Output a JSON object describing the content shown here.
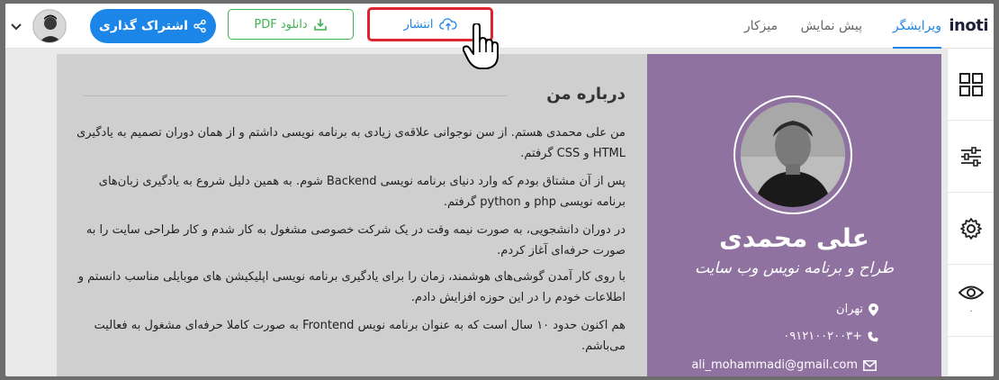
{
  "app": {
    "logo": "inoti"
  },
  "tabs": {
    "editor": "ویرایشگر",
    "preview": "پیش نمایش",
    "dashboard": "میزکار"
  },
  "toolbar": {
    "publish_label": "انتشار",
    "pdf_label": "دانلود PDF",
    "share_label": "اشتراک گذاری"
  },
  "about": {
    "title": "درباره من",
    "paragraphs": [
      "من علی محمدی هستم. از سن نوجوانی علاقه‌ی زیادی به برنامه نویسی داشتم و از همان دوران تصمیم به یادگیری HTML و CSS گرفتم.",
      "پس از آن مشتاق بودم که وارد دنیای برنامه نویسی Backend شوم. به همین دلیل شروع به یادگیری زبان‌های برنامه نویسی php و python گرفتم.",
      "در دوران دانشجویی، به صورت نیمه وقت در یک شرکت خصوصی مشغول به کار شدم و کار طراحی سایت را به صورت حرفه‌ای آغاز کردم.",
      "با روی کار آمدن گوشی‌های هوشمند، زمان را برای یادگیری برنامه نویسی اپلیکیشن های موبایلی مناسب دانستم و اطلاعات خودم را در این حوزه افزایش دادم.",
      "هم اکنون حدود ۱۰ سال است که به عنوان برنامه نویس Frontend به صورت کاملا حرفه‌ای مشغول به فعالیت می‌باشم."
    ]
  },
  "profile": {
    "name": "علی محمدی",
    "role": "طراح و برنامه نویس وب سایت",
    "city": "تهران",
    "phone": "+۰۹۱۲۱۰۰۲۰۰۳",
    "email": "ali_mohammadi@gmail.com"
  },
  "sidebar": {
    "eye_dot": "۰"
  },
  "colors": {
    "accent": "#1c86e8",
    "publish_border": "#e0242f",
    "pdf": "#3fb34f",
    "profile_bg": "#8f72a0",
    "about_bg": "#cfcfcf"
  }
}
